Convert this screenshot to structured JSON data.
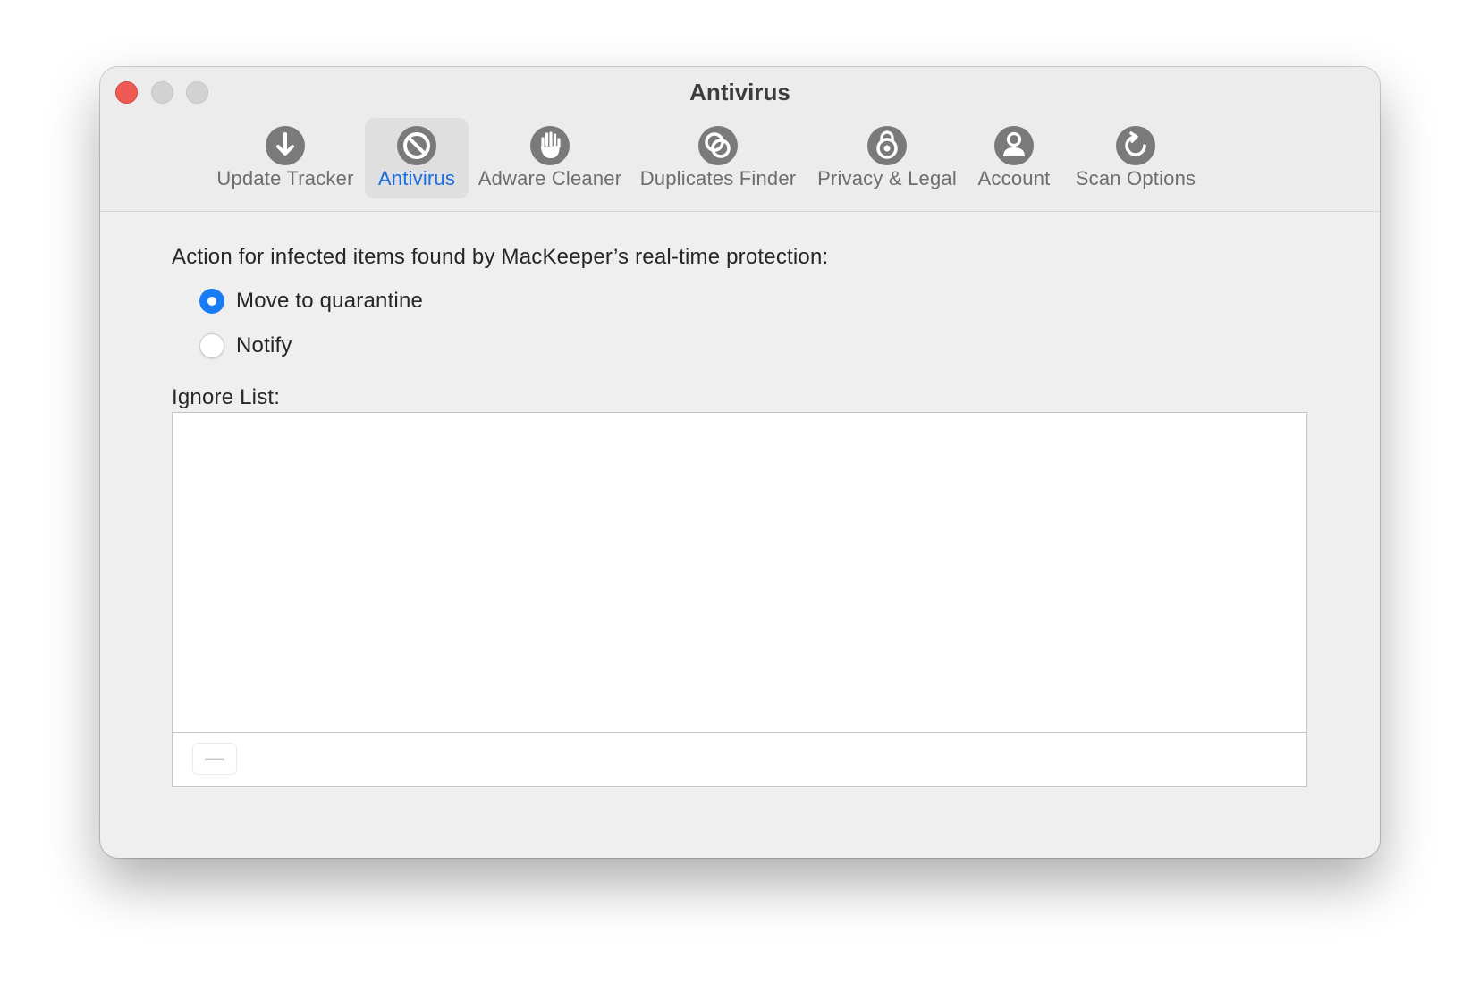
{
  "window": {
    "title": "Antivirus"
  },
  "toolbar": {
    "tabs": [
      {
        "label": "Update Tracker",
        "icon": "download-arrow-icon",
        "active": false
      },
      {
        "label": "Antivirus",
        "icon": "prohibited-icon",
        "active": true
      },
      {
        "label": "Adware Cleaner",
        "icon": "hand-icon",
        "active": false
      },
      {
        "label": "Duplicates Finder",
        "icon": "overlapping-circles-icon",
        "active": false
      },
      {
        "label": "Privacy & Legal",
        "icon": "lock-icon",
        "active": false
      },
      {
        "label": "Account",
        "icon": "person-icon",
        "active": false
      },
      {
        "label": "Scan Options",
        "icon": "refresh-icon",
        "active": false
      }
    ]
  },
  "antivirus": {
    "action_label": "Action for infected items found by MacKeeper’s real-time protection:",
    "options": [
      {
        "label": "Move to quarantine",
        "selected": true
      },
      {
        "label": "Notify",
        "selected": false
      }
    ],
    "ignore_list_label": "Ignore List:",
    "ignore_list_items": [],
    "remove_button_label": "—"
  },
  "colors": {
    "accent": "#1a7cf5",
    "active_tab_text": "#1d6ee0",
    "close_button": "#ee5b55",
    "icon_gray": "#7a7a7a"
  }
}
